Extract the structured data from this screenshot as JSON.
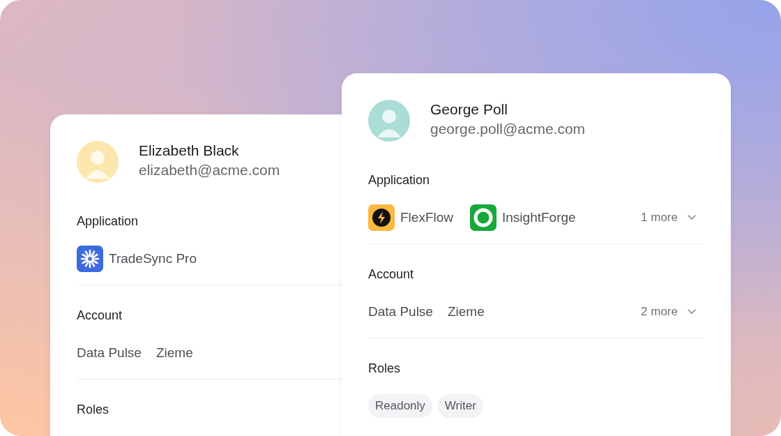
{
  "cards": [
    {
      "name": "Elizabeth Black",
      "email": "elizabeth@acme.com",
      "sections": [
        {
          "kind": "apps",
          "label": "Application",
          "items": [
            {
              "name": "TradeSync Pro",
              "kind": "asterisk"
            }
          ]
        },
        {
          "kind": "accounts",
          "label": "Account",
          "items": [
            "Data Pulse",
            "Zieme"
          ]
        },
        {
          "kind": "roles",
          "label": "Roles"
        }
      ]
    },
    {
      "name": "George Poll",
      "email": "george.poll@acme.com",
      "sections": [
        {
          "kind": "apps",
          "label": "Application",
          "items": [
            {
              "name": "FlexFlow",
              "kind": "bolt"
            },
            {
              "name": "InsightForge",
              "kind": "ring"
            }
          ],
          "more": "1 more"
        },
        {
          "kind": "accounts",
          "label": "Account",
          "items": [
            "Data Pulse",
            "Zieme"
          ],
          "more": "2 more"
        },
        {
          "kind": "roles",
          "label": "Roles",
          "items": [
            "Readonly",
            "Writer"
          ]
        }
      ]
    }
  ]
}
